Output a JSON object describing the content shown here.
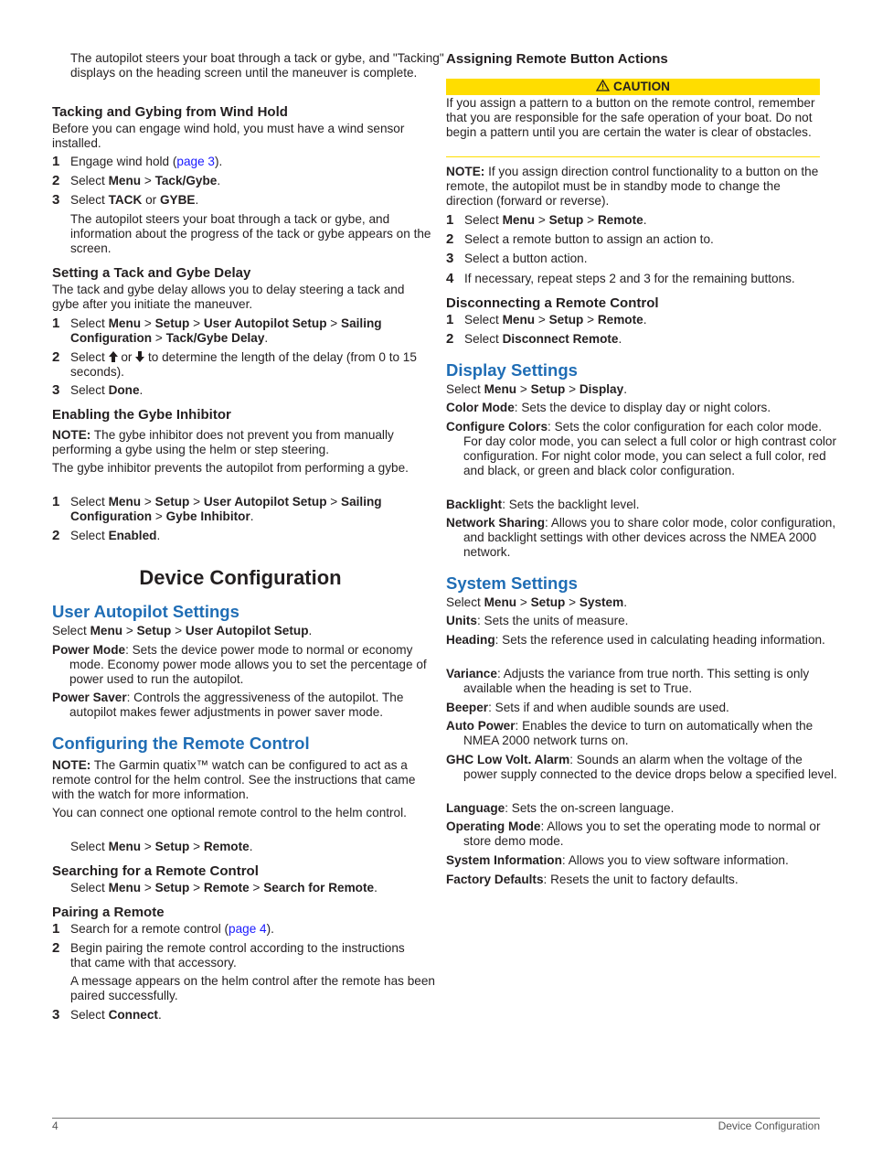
{
  "left": {
    "intro_para": "The autopilot steers your boat through a tack or gybe, and \"Tacking\" displays on the heading screen until the maneuver is complete.",
    "wind_hold": {
      "title": "Tacking and Gybing from Wind Hold",
      "para": "Before you can engage wind hold, you must have a wind sensor installed.",
      "steps": [
        {
          "num": "1",
          "pre": "Engage wind hold (",
          "link": "page 3",
          "post": ")."
        },
        {
          "num": "2",
          "pre": "Select ",
          "b1": "Menu",
          "sep1": " > ",
          "b2": "Tack/Gybe",
          "post": "."
        },
        {
          "num": "3",
          "pre": "Select ",
          "b1": "TACK",
          "sep1": " or ",
          "b2": "GYBE",
          "post": "."
        }
      ],
      "after_step": "The autopilot steers your boat through a tack or gybe, and information about the progress of the tack or gybe appears on the screen."
    },
    "delay": {
      "title": "Setting a Tack and Gybe Delay",
      "para": "The tack and gybe delay allows you to delay steering a tack and gybe after you initiate the maneuver.",
      "step1": {
        "num": "1",
        "pre": "Select ",
        "p1": "Menu",
        "p2": "Setup",
        "p3": "User Autopilot Setup",
        "p4": "Sailing Configuration",
        "p5": "Tack/Gybe Delay",
        "sep": " > ",
        "post": "."
      },
      "step2": {
        "num": "2",
        "pre": "Select ",
        "or": " or ",
        "post": " to determine the length of the delay (from 0 to 15 seconds).",
        "up_icon": "arrow-up",
        "down_icon": "arrow-down"
      },
      "step3": {
        "num": "3",
        "pre": "Select ",
        "b": "Done",
        "post": "."
      }
    },
    "inhibitor": {
      "title": "Enabling the Gybe Inhibitor",
      "note_label": "NOTE:",
      "note": " The gybe inhibitor does not prevent you from manually performing a gybe using the helm or step steering.",
      "para": "The gybe inhibitor prevents the autopilot from performing a gybe.",
      "step1": {
        "num": "1",
        "pre": "Select ",
        "p1": "Menu",
        "p2": "Setup",
        "p3": "User Autopilot Setup",
        "p4": "Sailing Configuration",
        "p5": "Gybe Inhibitor",
        "sep": " > ",
        "post": "."
      },
      "step2": {
        "num": "2",
        "pre": "Select ",
        "b": "Enabled",
        "post": "."
      }
    },
    "chapter_title": "Device Configuration",
    "user_autopilot": {
      "title": "User Autopilot Settings",
      "select": {
        "pre": "Select ",
        "p1": "Menu",
        "p2": "Setup",
        "p3": "User Autopilot Setup",
        "sep": " > ",
        "post": "."
      },
      "defs": [
        {
          "term": "Power Mode",
          "desc": ": Sets the device power mode to normal or economy mode. Economy power mode allows you to set the percentage of power used to run the autopilot."
        },
        {
          "term": "Power Saver",
          "desc": ": Controls the aggressiveness of the autopilot. The autopilot makes fewer adjustments in power saver mode."
        }
      ]
    },
    "remote": {
      "title": "Configuring the Remote Control",
      "note_label": "NOTE:",
      "note": " The Garmin quatix™ watch can be configured to act as a remote control for the helm control. See the instructions that came with the watch for more information.",
      "para": "You can connect one optional remote control to the helm control.",
      "select": {
        "pre": "Select ",
        "p1": "Menu",
        "p2": "Setup",
        "p3": "Remote",
        "sep": " > ",
        "post": "."
      }
    },
    "searching": {
      "title": "Searching for a Remote Control",
      "select": {
        "pre": "Select ",
        "p1": "Menu",
        "p2": "Setup",
        "p3": "Remote",
        "p4": "Search for Remote",
        "sep": " > ",
        "post": "."
      }
    },
    "pairing": {
      "title": "Pairing a Remote",
      "step1": {
        "num": "1",
        "pre": "Search for a remote control (",
        "link": "page 4",
        "post": ")."
      },
      "step2": {
        "num": "2",
        "text": "Begin pairing the remote control according to the instructions that came with that accessory."
      },
      "after_step2": "A message appears on the helm control after the remote has been paired successfully.",
      "step3": {
        "num": "3",
        "pre": "Select ",
        "b": "Connect",
        "post": "."
      }
    }
  },
  "right": {
    "assign": {
      "title": "Assigning Remote Button Actions",
      "caution_label": "CAUTION",
      "caution_icon": "warning-triangle",
      "caution_text": "If you assign a pattern to a button on the remote control, remember that you are responsible for the safe operation of your boat. Do not begin a pattern until you are certain the water is clear of obstacles.",
      "note_label": "NOTE:",
      "note": " If you assign direction control functionality to a button on the remote, the autopilot must be in standby mode to change the direction (forward or reverse).",
      "step1": {
        "num": "1",
        "pre": "Select ",
        "p1": "Menu",
        "p2": "Setup",
        "p3": "Remote",
        "sep": " > ",
        "post": "."
      },
      "step2": {
        "num": "2",
        "text": "Select a remote button to assign an action to."
      },
      "step3": {
        "num": "3",
        "text": "Select a button action."
      },
      "step4": {
        "num": "4",
        "text": "If necessary, repeat steps 2 and 3 for the remaining buttons."
      }
    },
    "disconnect": {
      "title": "Disconnecting a Remote Control",
      "step1": {
        "num": "1",
        "pre": "Select ",
        "p1": "Menu",
        "p2": "Setup",
        "p3": "Remote",
        "sep": " > ",
        "post": "."
      },
      "step2": {
        "num": "2",
        "pre": "Select ",
        "b": "Disconnect Remote",
        "post": "."
      }
    },
    "display": {
      "title": "Display Settings",
      "select": {
        "pre": "Select ",
        "p1": "Menu",
        "p2": "Setup",
        "p3": "Display",
        "sep": " > ",
        "post": "."
      },
      "defs": [
        {
          "term": "Color Mode",
          "desc": ": Sets the device to display day or night colors."
        },
        {
          "term": "Configure Colors",
          "desc": ": Sets the color configuration for each color mode. For day color mode, you can select a full color or high contrast color configuration. For night color mode, you can select a full color, red and black, or green and black color configuration."
        },
        {
          "term": "Backlight",
          "desc": ": Sets the backlight level."
        },
        {
          "term": "Network Sharing",
          "desc": ": Allows you to share color mode, color configuration, and backlight settings with other devices across the NMEA 2000 network."
        }
      ]
    },
    "system": {
      "title": "System Settings",
      "select": {
        "pre": "Select ",
        "p1": "Menu",
        "p2": "Setup",
        "p3": "System",
        "sep": " > ",
        "post": "."
      },
      "defs": [
        {
          "term": "Units",
          "desc": ": Sets the units of measure."
        },
        {
          "term": "Heading",
          "desc": ": Sets the reference used in calculating heading information."
        },
        {
          "term": "Variance",
          "desc": ": Adjusts the variance from true north. This setting is only available when the heading is set to True."
        },
        {
          "term": "Beeper",
          "desc": ": Sets if and when audible sounds are used."
        },
        {
          "term": "Auto Power",
          "desc": ": Enables the device to turn on automatically when the NMEA 2000 network turns on."
        },
        {
          "term": "GHC Low Volt. Alarm",
          "desc": ": Sounds an alarm when the voltage of the power supply connected to the device drops below a specified level."
        },
        {
          "term": "Language",
          "desc": ": Sets the on-screen language."
        },
        {
          "term": "Operating Mode",
          "desc": ": Allows you to set the operating mode to normal or store demo mode."
        },
        {
          "term": "System Information",
          "desc": ": Allows you to view software information."
        },
        {
          "term": "Factory Defaults",
          "desc": ": Resets the unit to factory defaults."
        }
      ]
    }
  },
  "footer": {
    "page_number": "4",
    "section": "Device Configuration"
  },
  "colors": {
    "heading_blue": "#1f6db5",
    "caution_yellow": "#ffdd00",
    "link_blue": "#1a1aff",
    "text": "#231f20"
  }
}
